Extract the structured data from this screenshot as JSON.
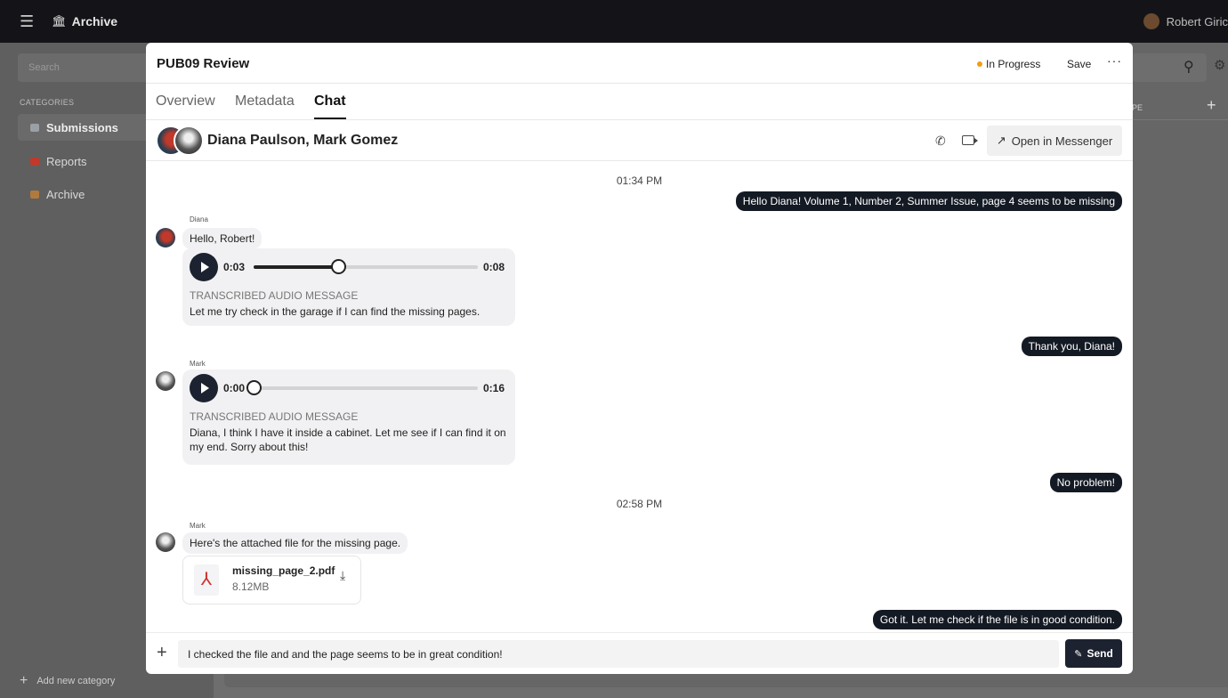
{
  "app": {
    "name": "Archive",
    "user": "Robert Giric"
  },
  "sidebar": {
    "search_placeholder": "Search",
    "categories_title": "CATEGORIES",
    "items": [
      {
        "label": "Submissions",
        "icon": "mail-icon",
        "color": "#9aa0a6"
      },
      {
        "label": "Reports",
        "icon": "report-icon",
        "color": "#c0392b"
      },
      {
        "label": "Archive",
        "icon": "box-icon",
        "color": "#b07a3c"
      }
    ],
    "add_category": "Add new category"
  },
  "background": {
    "type_header": "TYPE"
  },
  "modal": {
    "title": "PUB09 Review",
    "status": "In Progress",
    "status_color": "#f39c12",
    "save": "Save",
    "more": "···",
    "tabs": [
      "Overview",
      "Metadata",
      "Chat"
    ],
    "active_tab": "Chat"
  },
  "chat": {
    "participants": "Diana Paulson, Mark Gomez",
    "open_messenger": "Open in Messenger",
    "times": [
      "01:34 PM",
      "02:58 PM"
    ],
    "out_messages": [
      "Hello Diana! Volume 1, Number 2, Summer Issue, page 4 seems to be missing",
      "Thank you, Diana!",
      "No problem!",
      "Got it. Let me check if the file is in good condition."
    ],
    "diana": {
      "sender": "Diana",
      "text": "Hello, Robert!",
      "audio": {
        "current": "0:03",
        "total": "0:08",
        "progress": 0.375,
        "label": "TRANSCRIBED AUDIO MESSAGE",
        "transcript": "Let me try check in the garage if I can find the missing pages."
      }
    },
    "mark1": {
      "sender": "Mark",
      "audio": {
        "current": "0:00",
        "total": "0:16",
        "progress": 0,
        "label": "TRANSCRIBED AUDIO MESSAGE",
        "transcript": "Diana, I think I have it inside a cabinet. Let me see if I can find it on my end. Sorry about this!"
      }
    },
    "mark2": {
      "sender": "Mark",
      "text": "Here's the attached file for the missing page.",
      "file": {
        "name": "missing_page_2.pdf",
        "size": "8.12MB"
      }
    },
    "composer": {
      "value": "I checked the file and and the page seems to be in great condition!",
      "send": "Send"
    }
  }
}
